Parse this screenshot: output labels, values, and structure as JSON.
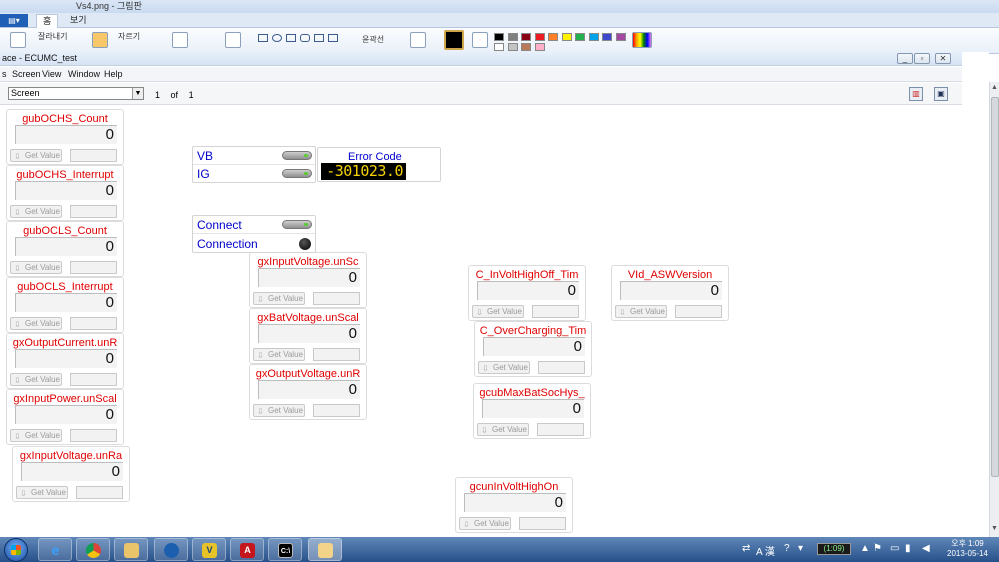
{
  "paint": {
    "title": "Vs4.png - 그림판",
    "tabs": [
      "홈",
      "보기"
    ],
    "ribbon": {
      "cut_label": "잘라내기",
      "crop_label": "자르기",
      "outline_label": "윤곽선"
    },
    "colors": [
      "#000000",
      "#7f7f7f",
      "#880015",
      "#ed1c24",
      "#ff7f27",
      "#fff200",
      "#22b14c",
      "#00a2e8",
      "#3f48cc",
      "#a349a4",
      "#ffffff",
      "#c3c3c3",
      "#b97a57",
      "#ffaec9"
    ]
  },
  "app": {
    "title": "ace - ECUMC_test",
    "menu": [
      "s",
      "Screen",
      "View",
      "Window",
      "Help"
    ],
    "screen_select": "Screen",
    "page_current": "1",
    "page_of": "of",
    "page_total": "1"
  },
  "get_value_label": "Get Value",
  "widgets_left": [
    {
      "label": "gubOCHS_Count",
      "value": "0"
    },
    {
      "label": "gubOCHS_Interrupt",
      "value": "0"
    },
    {
      "label": "gubOCLS_Count",
      "value": "0"
    },
    {
      "label": "gubOCLS_Interrupt",
      "value": "0"
    },
    {
      "label": "gxOutputCurrent.unR",
      "value": "0"
    },
    {
      "label": "gxInputPower.unScal",
      "value": "0"
    },
    {
      "label": "gxInputVoltage.unRa",
      "value": "0"
    }
  ],
  "widgets_mid": [
    {
      "label": "gxInputVoltage.unSc",
      "value": "0"
    },
    {
      "label": "gxBatVoltage.unScal",
      "value": "0"
    },
    {
      "label": "gxOutputVoltage.unR",
      "value": "0"
    }
  ],
  "widgets_right": [
    {
      "label": "C_InVoltHighOff_Tim",
      "value": "0"
    },
    {
      "label": "C_OverCharging_Tim",
      "value": "0"
    },
    {
      "label": "gcubMaxBatSocHys_",
      "value": "0"
    },
    {
      "label": "gcunInVoltHighOn",
      "value": "0"
    },
    {
      "label": "VId_ASWVersion",
      "value": "0"
    }
  ],
  "switches": {
    "vb": "VB",
    "ig": "IG",
    "connect": "Connect",
    "connection": "Connection"
  },
  "error_code": {
    "label": "Error Code",
    "value": "-301023.0"
  },
  "taskbar": {
    "tray_lang": "A 漢",
    "battery_time": "(1:09)",
    "clock_ampm": "오후 1:09",
    "clock_date": "2013-05-14"
  }
}
